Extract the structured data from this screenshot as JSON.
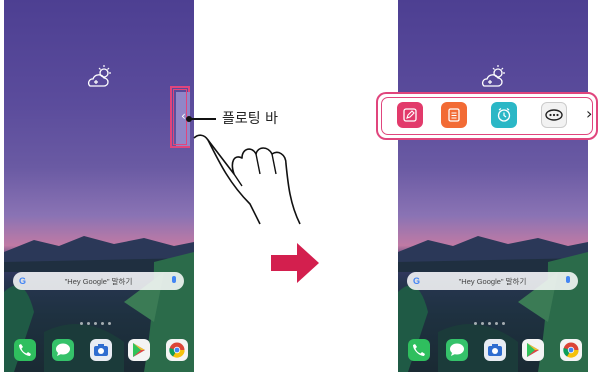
{
  "callout": {
    "label": "플로팅 바"
  },
  "search": {
    "logo": "G",
    "hint": "\"Hey Google\" 말하기"
  },
  "floating_bar": {
    "apps": [
      {
        "icon": "memo-pencil-icon"
      },
      {
        "icon": "notes-icon"
      },
      {
        "icon": "clock-icon"
      },
      {
        "icon": "more-icon"
      }
    ],
    "next": "›"
  },
  "dock": {
    "apps": [
      "phone-icon",
      "messages-icon",
      "camera-icon",
      "play-store-icon",
      "chrome-icon"
    ]
  },
  "colors": {
    "highlight": "#e0457d",
    "wallpaper_top": "#4d3f92",
    "handle": "#9186c8"
  }
}
